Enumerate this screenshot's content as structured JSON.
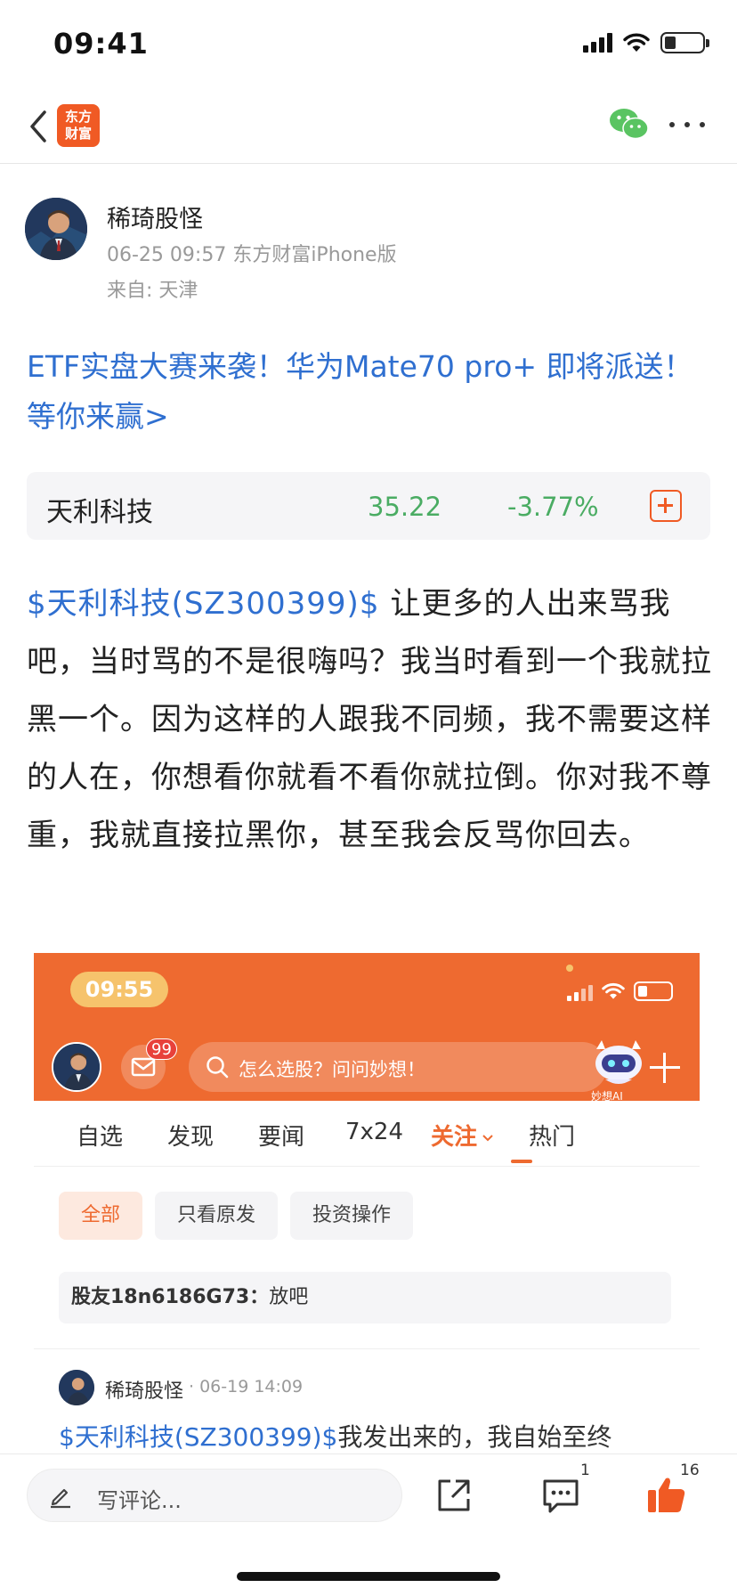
{
  "status_bar": {
    "time": "09:41",
    "battery_level": 0.3
  },
  "nav": {
    "logo_line1": "东方",
    "logo_line2": "财富"
  },
  "author": {
    "name": "稀琦股怪",
    "meta": "06-25 09:57 东方财富iPhone版",
    "from": "来自: 天津"
  },
  "promo": {
    "text": "ETF实盘大赛来袭！华为Mate70 pro+ 即将派送！等你来赢>"
  },
  "stock": {
    "name": "天利科技",
    "price": "35.22",
    "change": "-3.77%"
  },
  "post": {
    "tag": "$天利科技(SZ300399)$",
    "text": "让更多的人出来骂我吧，当时骂的不是很嗨吗？我当时看到一个我就拉黑一个。因为这样的人跟我不同频，我不需要这样的人在，你想看你就看不看你就拉倒。你对我不尊重，我就直接拉黑你，甚至我会反骂你回去。"
  },
  "screenshot": {
    "time": "09:55",
    "mail_badge": "99",
    "search_placeholder": "怎么选股？问问妙想！",
    "ai_label": "妙想AI",
    "tabs": [
      "自选",
      "发现",
      "要闻",
      "7x24",
      "关注",
      "热门"
    ],
    "active_tab": "关注",
    "chips": [
      "全部",
      "只看原发",
      "投资操作"
    ],
    "comment_user": "股友18n6186G73：",
    "comment_text": "放吧",
    "author_name": "稀琦股怪",
    "author_time": "· 06-19 14:09",
    "post_tag": "$天利科技(SZ300399)$",
    "post_text": "我发出来的，我自始至终"
  },
  "bottom_bar": {
    "comment_placeholder": "写评论...",
    "comment_count": "1",
    "like_count": "16"
  },
  "colors": {
    "brand_orange": "#f05a24",
    "link_blue": "#2f6fd0",
    "down_green": "#4aac63"
  }
}
